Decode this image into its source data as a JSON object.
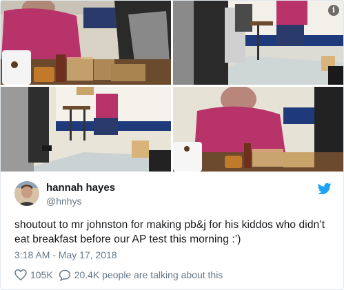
{
  "media": {
    "info_label": "i",
    "photos": [
      {
        "name": "teacher-making-sandwiches-closeup"
      },
      {
        "name": "hallway-table-students-waiting"
      },
      {
        "name": "hallway-table-wide-view"
      },
      {
        "name": "teacher-spreading-peanut-butter"
      }
    ]
  },
  "user": {
    "display_name": "hannah hayes",
    "handle": "@hnhys"
  },
  "tweet": {
    "text": "shoutout to mr johnston for making pb&j for his kiddos who didn’t eat breakfast before our AP test this morning :’)",
    "timestamp": "3:18 AM - May 17, 2018"
  },
  "actions": {
    "likes": "105K",
    "talking": "20.4K people are talking about this"
  },
  "colors": {
    "twitter_blue": "#1da1f2",
    "meta_gray": "#657786",
    "text": "#14171a"
  }
}
